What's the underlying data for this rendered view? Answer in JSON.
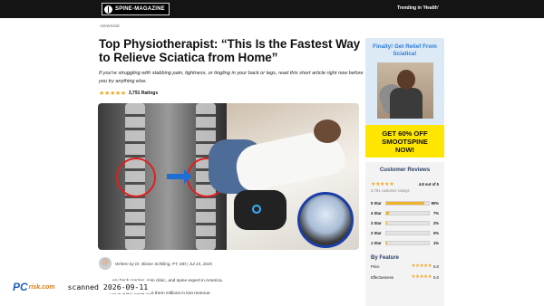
{
  "header": {
    "logo_text": "SPINE-MAGAZINE",
    "trending": "Trending in 'Health'"
  },
  "article": {
    "advertorial": "Advertorial",
    "headline": "Top Physiotherapist: “This Is the Fastest Way to Relieve Sciatica from Home”",
    "subhead": "If you’re struggling with stabbing pain, tightness, or tingling in your back or legs, read this short article right now before you try anything else.",
    "rating_stars": "★★★★★",
    "rating_text": "3,791 Ratings",
    "author_line": "Written by Dr. Blaine Schilling, PT, MD | Jul 15, 2025",
    "body_line_1": "...ery back cracker, pain clinic, and spine expert in America.",
    "body_line_2": "...ot to share could cost them millions in lost revenue."
  },
  "sidebar": {
    "promo_title": "Finally! Get Relief From Sciatica!",
    "cta_line_1": "GET 60% OFF",
    "cta_line_2": "SMOOTSPINE",
    "cta_line_3": "NOW!"
  },
  "reviews": {
    "title": "Customer Reviews",
    "overall_stars": "★★★★★",
    "overall_text": "4.8 out of 5",
    "overall_count": "3,791 customer ratings",
    "bars": [
      {
        "label": "5 Star",
        "percent": 90,
        "percent_text": "90%"
      },
      {
        "label": "4 Star",
        "percent": 7,
        "percent_text": "7%"
      },
      {
        "label": "3 Star",
        "percent": 2,
        "percent_text": "2%"
      },
      {
        "label": "2 Star",
        "percent": 0,
        "percent_text": "0%"
      },
      {
        "label": "1 Star",
        "percent": 1,
        "percent_text": "1%"
      }
    ],
    "feature_title": "By Feature",
    "features": [
      {
        "name": "Price",
        "stars": "★★★★★",
        "value": "5.0"
      },
      {
        "name": "Effectiveness",
        "stars": "★★★★★",
        "value": "5.0"
      }
    ]
  },
  "watermark": {
    "logo_pc": "PC",
    "logo_risk": "risk.com",
    "scan_text": "scanned 2026-09-11"
  },
  "colors": {
    "topbar": "#141414",
    "accent_blue": "#2c7ad8",
    "cta_yellow": "#ffe600",
    "star_gold": "#f5a623",
    "bar_fill": "#f2b32a"
  }
}
